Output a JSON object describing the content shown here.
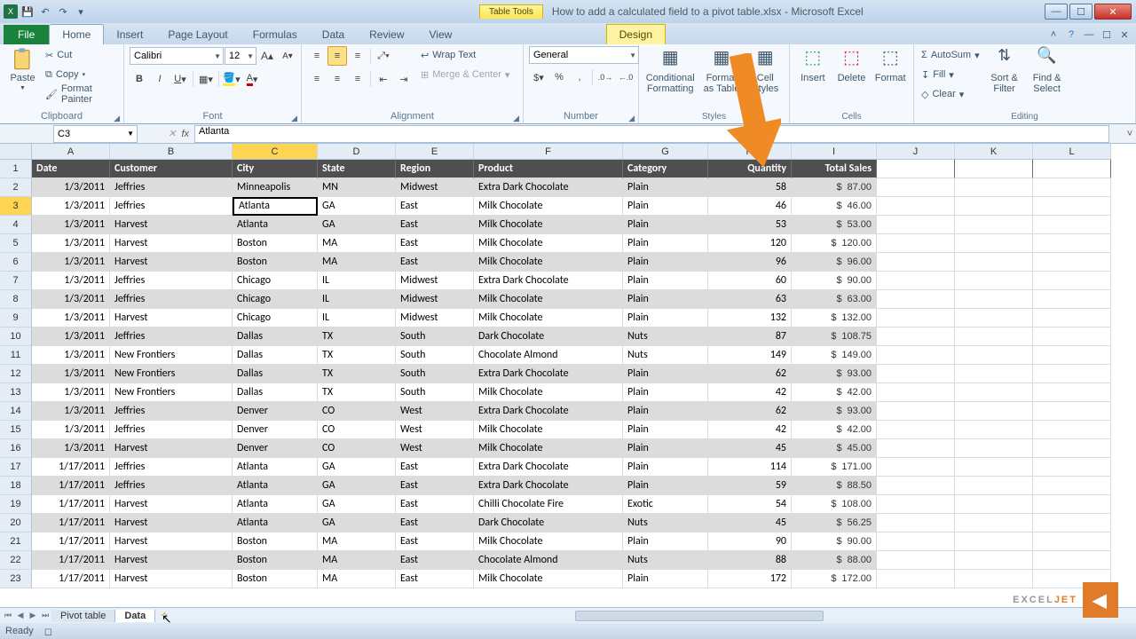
{
  "title": {
    "context_tab": "Table Tools",
    "document": "How to add a calculated field to a pivot table.xlsx - Microsoft Excel"
  },
  "ribbon": {
    "file": "File",
    "tabs": [
      "Home",
      "Insert",
      "Page Layout",
      "Formulas",
      "Data",
      "Review",
      "View"
    ],
    "design": "Design",
    "clipboard": {
      "paste": "Paste",
      "cut": "Cut",
      "copy": "Copy",
      "format_painter": "Format Painter",
      "label": "Clipboard"
    },
    "font": {
      "name": "Calibri",
      "size": "12",
      "label": "Font"
    },
    "alignment": {
      "wrap": "Wrap Text",
      "merge": "Merge & Center",
      "label": "Alignment"
    },
    "number": {
      "format": "General",
      "label": "Number"
    },
    "styles": {
      "cond": "Conditional Formatting",
      "table": "Format as Table",
      "cellstyles": "Cell Styles",
      "label": "Styles"
    },
    "cells": {
      "insert": "Insert",
      "delete": "Delete",
      "format": "Format",
      "label": "Cells"
    },
    "editing": {
      "autosum": "AutoSum",
      "fill": "Fill",
      "clear": "Clear",
      "sort": "Sort & Filter",
      "find": "Find & Select",
      "label": "Editing"
    }
  },
  "namebox": "C3",
  "formula": "Atlanta",
  "columns": [
    "A",
    "B",
    "C",
    "D",
    "E",
    "F",
    "G",
    "H",
    "I",
    "J",
    "K",
    "L"
  ],
  "headers": [
    "Date",
    "Customer",
    "City",
    "State",
    "Region",
    "Product",
    "Category",
    "Quantity",
    "Total Sales"
  ],
  "selected": {
    "cell": "C3",
    "row": 3,
    "col": "C"
  },
  "rows": [
    {
      "n": 2,
      "d": [
        "1/3/2011",
        "Jeffries",
        "Minneapolis",
        "MN",
        "Midwest",
        "Extra Dark Chocolate",
        "Plain",
        "58",
        "$",
        "87.00"
      ]
    },
    {
      "n": 3,
      "d": [
        "1/3/2011",
        "Jeffries",
        "Atlanta",
        "GA",
        "East",
        "Milk Chocolate",
        "Plain",
        "46",
        "$",
        "46.00"
      ]
    },
    {
      "n": 4,
      "d": [
        "1/3/2011",
        "Harvest",
        "Atlanta",
        "GA",
        "East",
        "Milk Chocolate",
        "Plain",
        "53",
        "$",
        "53.00"
      ]
    },
    {
      "n": 5,
      "d": [
        "1/3/2011",
        "Harvest",
        "Boston",
        "MA",
        "East",
        "Milk Chocolate",
        "Plain",
        "120",
        "$",
        "120.00"
      ]
    },
    {
      "n": 6,
      "d": [
        "1/3/2011",
        "Harvest",
        "Boston",
        "MA",
        "East",
        "Milk Chocolate",
        "Plain",
        "96",
        "$",
        "96.00"
      ]
    },
    {
      "n": 7,
      "d": [
        "1/3/2011",
        "Jeffries",
        "Chicago",
        "IL",
        "Midwest",
        "Extra Dark Chocolate",
        "Plain",
        "60",
        "$",
        "90.00"
      ]
    },
    {
      "n": 8,
      "d": [
        "1/3/2011",
        "Jeffries",
        "Chicago",
        "IL",
        "Midwest",
        "Milk Chocolate",
        "Plain",
        "63",
        "$",
        "63.00"
      ]
    },
    {
      "n": 9,
      "d": [
        "1/3/2011",
        "Harvest",
        "Chicago",
        "IL",
        "Midwest",
        "Milk Chocolate",
        "Plain",
        "132",
        "$",
        "132.00"
      ]
    },
    {
      "n": 10,
      "d": [
        "1/3/2011",
        "Jeffries",
        "Dallas",
        "TX",
        "South",
        "Dark Chocolate",
        "Nuts",
        "87",
        "$",
        "108.75"
      ]
    },
    {
      "n": 11,
      "d": [
        "1/3/2011",
        "New Frontiers",
        "Dallas",
        "TX",
        "South",
        "Chocolate Almond",
        "Nuts",
        "149",
        "$",
        "149.00"
      ]
    },
    {
      "n": 12,
      "d": [
        "1/3/2011",
        "New Frontiers",
        "Dallas",
        "TX",
        "South",
        "Extra Dark Chocolate",
        "Plain",
        "62",
        "$",
        "93.00"
      ]
    },
    {
      "n": 13,
      "d": [
        "1/3/2011",
        "New Frontiers",
        "Dallas",
        "TX",
        "South",
        "Milk Chocolate",
        "Plain",
        "42",
        "$",
        "42.00"
      ]
    },
    {
      "n": 14,
      "d": [
        "1/3/2011",
        "Jeffries",
        "Denver",
        "CO",
        "West",
        "Extra Dark Chocolate",
        "Plain",
        "62",
        "$",
        "93.00"
      ]
    },
    {
      "n": 15,
      "d": [
        "1/3/2011",
        "Jeffries",
        "Denver",
        "CO",
        "West",
        "Milk Chocolate",
        "Plain",
        "42",
        "$",
        "42.00"
      ]
    },
    {
      "n": 16,
      "d": [
        "1/3/2011",
        "Harvest",
        "Denver",
        "CO",
        "West",
        "Milk Chocolate",
        "Plain",
        "45",
        "$",
        "45.00"
      ]
    },
    {
      "n": 17,
      "d": [
        "1/17/2011",
        "Jeffries",
        "Atlanta",
        "GA",
        "East",
        "Extra Dark Chocolate",
        "Plain",
        "114",
        "$",
        "171.00"
      ]
    },
    {
      "n": 18,
      "d": [
        "1/17/2011",
        "Jeffries",
        "Atlanta",
        "GA",
        "East",
        "Extra Dark Chocolate",
        "Plain",
        "59",
        "$",
        "88.50"
      ]
    },
    {
      "n": 19,
      "d": [
        "1/17/2011",
        "Harvest",
        "Atlanta",
        "GA",
        "East",
        "Chilli Chocolate Fire",
        "Exotic",
        "54",
        "$",
        "108.00"
      ]
    },
    {
      "n": 20,
      "d": [
        "1/17/2011",
        "Harvest",
        "Atlanta",
        "GA",
        "East",
        "Dark Chocolate",
        "Nuts",
        "45",
        "$",
        "56.25"
      ]
    },
    {
      "n": 21,
      "d": [
        "1/17/2011",
        "Harvest",
        "Boston",
        "MA",
        "East",
        "Milk Chocolate",
        "Plain",
        "90",
        "$",
        "90.00"
      ]
    },
    {
      "n": 22,
      "d": [
        "1/17/2011",
        "Harvest",
        "Boston",
        "MA",
        "East",
        "Chocolate Almond",
        "Nuts",
        "88",
        "$",
        "88.00"
      ]
    },
    {
      "n": 23,
      "d": [
        "1/17/2011",
        "Harvest",
        "Boston",
        "MA",
        "East",
        "Milk Chocolate",
        "Plain",
        "172",
        "$",
        "172.00"
      ]
    }
  ],
  "sheettabs": {
    "tabs": [
      "Pivot table",
      "Data"
    ],
    "active": "Data"
  },
  "status": "Ready",
  "watermark": {
    "a": "EXCEL",
    "b": "JET"
  }
}
